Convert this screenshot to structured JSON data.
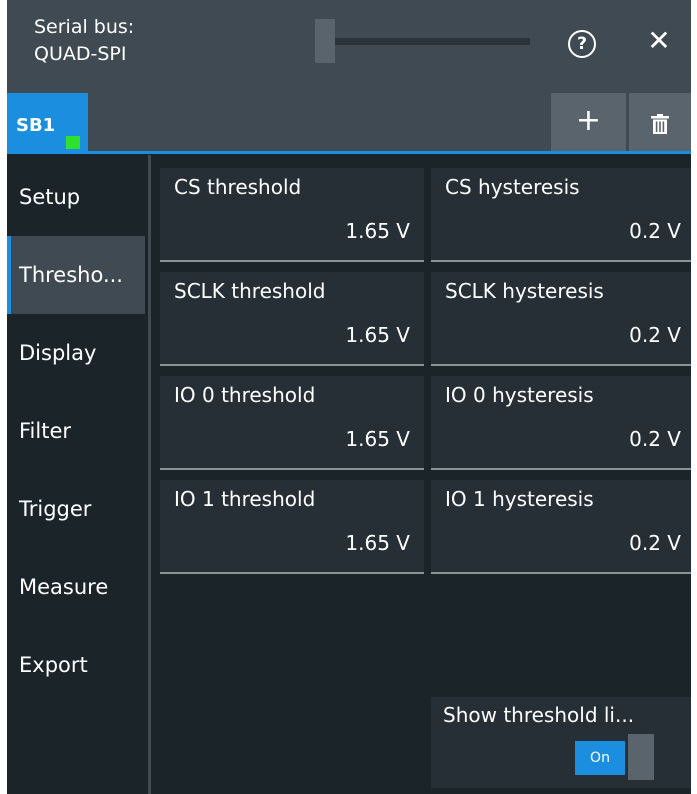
{
  "title": {
    "line1": "Serial bus:",
    "line2": "QUAD-SPI"
  },
  "icons": {
    "help": "help-icon",
    "close": "close-icon",
    "add": "plus-icon",
    "delete": "trash-icon"
  },
  "help_glyph": "?",
  "close_glyph": "✕",
  "add_glyph": "+",
  "tabs": [
    {
      "label": "SB1",
      "indicator_color": "#2fe02f"
    }
  ],
  "sidebar": {
    "items": [
      {
        "label": "Setup"
      },
      {
        "label": "Thresho..."
      },
      {
        "label": "Display"
      },
      {
        "label": "Filter"
      },
      {
        "label": "Trigger"
      },
      {
        "label": "Measure"
      },
      {
        "label": "Export"
      }
    ],
    "active_index": 1
  },
  "fields": [
    {
      "label": "CS threshold",
      "value": "1.65 V"
    },
    {
      "label": "CS hysteresis",
      "value": "0.2 V"
    },
    {
      "label": "SCLK threshold",
      "value": "1.65 V"
    },
    {
      "label": "SCLK hysteresis",
      "value": "0.2 V"
    },
    {
      "label": "IO 0 threshold",
      "value": "1.65 V"
    },
    {
      "label": "IO 0 hysteresis",
      "value": "0.2 V"
    },
    {
      "label": "IO 1 threshold",
      "value": "1.65 V"
    },
    {
      "label": "IO 1 hysteresis",
      "value": "0.2 V"
    }
  ],
  "show_threshold": {
    "label": "Show threshold li...",
    "state": "On"
  },
  "colors": {
    "accent": "#1b8ee0",
    "background": "#1b2429",
    "panel": "#3f4a52",
    "field": "#262f35"
  }
}
